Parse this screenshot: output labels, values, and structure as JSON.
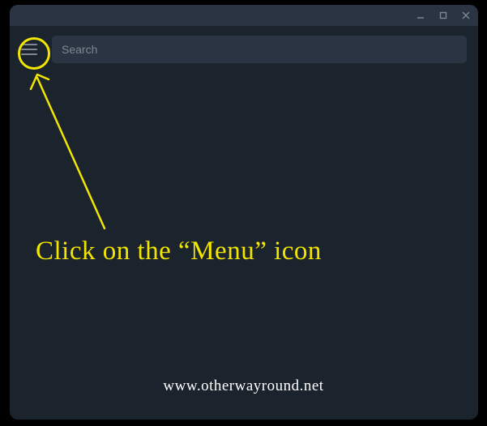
{
  "search": {
    "placeholder": "Search",
    "value": ""
  },
  "annotation": {
    "text": "Click on the “Menu” icon"
  },
  "watermark": "www.otherwayround.net"
}
